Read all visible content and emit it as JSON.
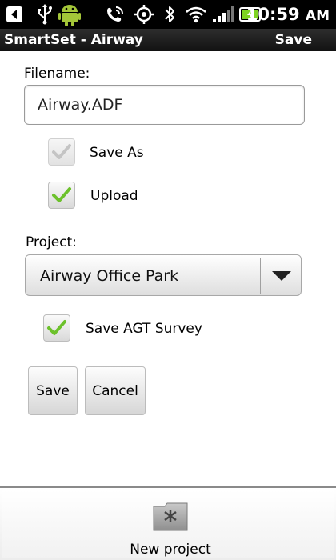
{
  "status_bar": {
    "time": "10:59",
    "ampm": "AM",
    "icons": [
      "back-icon",
      "usb-icon",
      "android-icon",
      "phone-signal-icon",
      "gps-icon",
      "bluetooth-icon",
      "wifi-icon",
      "signal-bars-icon",
      "battery-charging-icon"
    ]
  },
  "title_bar": {
    "title": "SmartSet - Airway",
    "save_label": "Save"
  },
  "form": {
    "filename_label": "Filename:",
    "filename_value": "Airway.ADF",
    "save_as": {
      "label": "Save As",
      "checked": true,
      "enabled": false
    },
    "upload": {
      "label": "Upload",
      "checked": true,
      "enabled": true
    },
    "project_label": "Project:",
    "project_selected": "Airway Office Park",
    "save_agt": {
      "label": "Save AGT Survey",
      "checked": true,
      "enabled": true
    }
  },
  "buttons": {
    "save": "Save",
    "cancel": "Cancel"
  },
  "bottom_bar": {
    "new_project_label": "New project",
    "icon": "folder-new-icon"
  },
  "colors": {
    "check_enabled": "#6cc12b",
    "check_disabled": "#c8c8c8",
    "battery_green": "#7ed321"
  }
}
